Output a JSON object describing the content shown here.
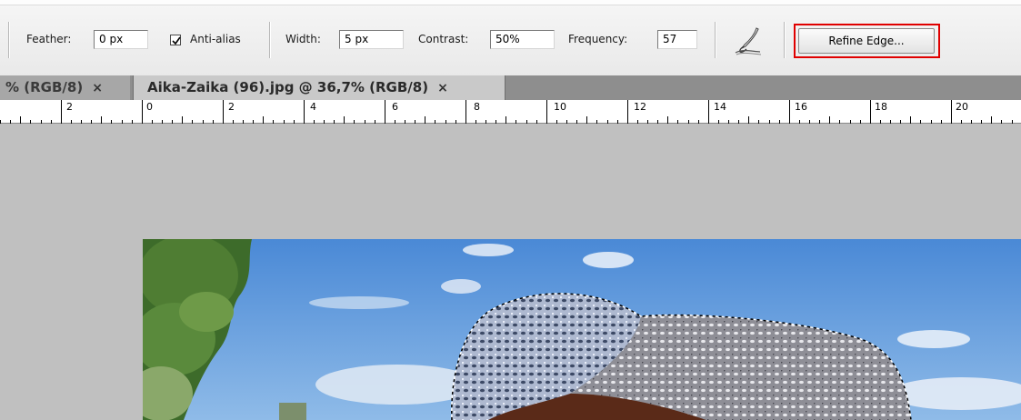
{
  "options_bar": {
    "feather_label": "Feather:",
    "feather_value": "0 px",
    "anti_alias_label": "Anti-alias",
    "anti_alias_checked": true,
    "width_label": "Width:",
    "width_value": "5 px",
    "contrast_label": "Contrast:",
    "contrast_value": "50%",
    "frequency_label": "Frequency:",
    "frequency_value": "57",
    "pen_pressure_icon": "stylus-pressure-icon",
    "refine_edge_label": "Refine Edge..."
  },
  "tabs": [
    {
      "label": "% (RGB/8)",
      "close": "×",
      "active": false
    },
    {
      "label": "Aika-Zaika (96).jpg @ 36,7% (RGB/8)",
      "close": "×",
      "active": true
    }
  ],
  "ruler": {
    "labels": [
      "2",
      "0",
      "2",
      "4",
      "6",
      "8",
      "10",
      "12",
      "14",
      "16",
      "18",
      "20"
    ]
  },
  "colors": {
    "highlight": "#e00000",
    "canvas_bg": "#c0c0c0",
    "tab_bar": "#8e8e8e"
  },
  "image": {
    "description_icon": "photo-canvas"
  }
}
